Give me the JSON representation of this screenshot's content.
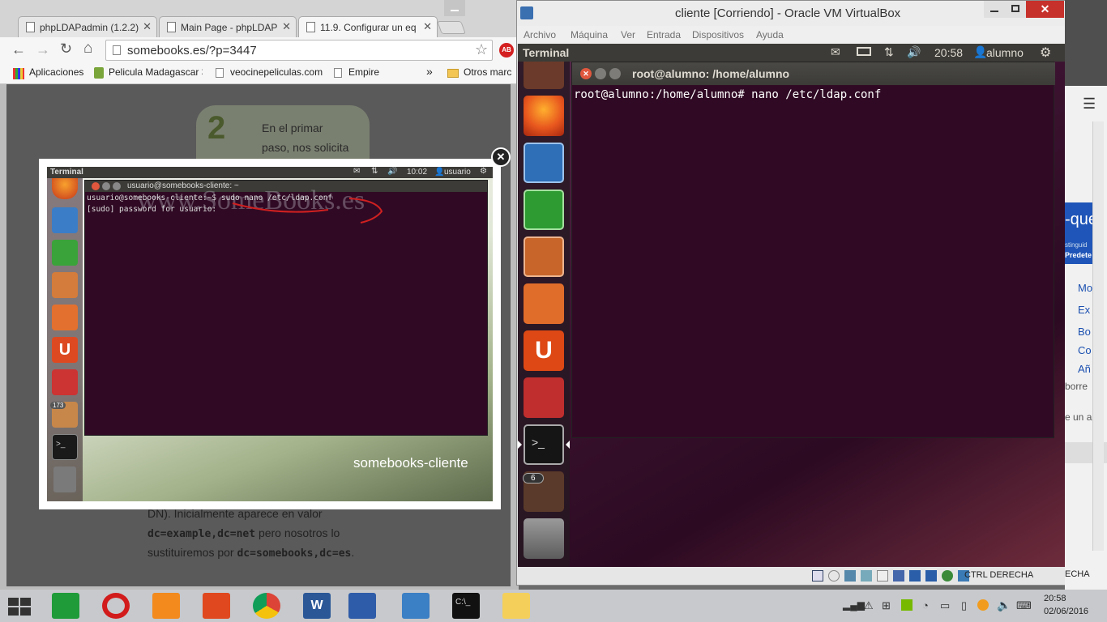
{
  "chrome": {
    "tabs": [
      {
        "label": "phpLDAPadmin (1.2.2)"
      },
      {
        "label": "Main Page - phpLDAP"
      },
      {
        "label": "11.9. Configurar un eq"
      }
    ],
    "url": "somebooks.es/?p=3447",
    "bookmarks": [
      {
        "label": "Aplicaciones"
      },
      {
        "label": "Pelicula Madagascar 3"
      },
      {
        "label": "veocinepeliculas.com"
      },
      {
        "label": "Empire"
      },
      {
        "label": "Otros marc"
      }
    ],
    "more": "»"
  },
  "article": {
    "step_number": "2",
    "step_text_1": "En el primar",
    "step_text_2": "paso, nos solicita",
    "body_1": "DN). Inicialmente aparece en valor",
    "code_1": "dc=example,dc=net",
    "body_2": " pero nosotros lo",
    "body_3": "sustituiremos por ",
    "code_2": "dc=somebooks,dc=es",
    "body_4": "."
  },
  "popup": {
    "close": "✕",
    "panel_title": "Terminal",
    "clock": "10:02",
    "user": "usuario",
    "window_title": "usuario@somebooks-cliente: ~",
    "line1": "usuario@somebooks-cliente:~$ sudo nano /etc/ldap.conf",
    "line2": "[sudo] password for usuario:",
    "watermark": "www.SomeBooks.es",
    "hostname": "somebooks-cliente",
    "badge": "173"
  },
  "vbox": {
    "title": "cliente [Corriendo] - Oracle VM VirtualBox",
    "menu": [
      "Archivo",
      "Máquina",
      "Ver",
      "Entrada",
      "Dispositivos",
      "Ayuda"
    ],
    "panel_title": "Terminal",
    "clock": "20:58",
    "user": "alumno",
    "term_title": "root@alumno: /home/alumno",
    "term_line": "root@alumno:/home/alumno# nano /etc/ldap.conf",
    "badge": "6",
    "host_key": "CTRL DERECHA"
  },
  "rstrip": {
    "heading": "-que",
    "sub1": "stinguid",
    "sub2": "Predete",
    "items": [
      "Mo",
      "Ex",
      "Bo",
      "Co",
      "Añ"
    ],
    "text1": "borre",
    "text2": "e un a",
    "status": "ECHA"
  },
  "taskbar": {
    "time": "20:58",
    "date": "02/06/2016"
  },
  "colors": {
    "ubuntu_term": "#300a24",
    "unity_panel": "#3c3b37",
    "taskbar": "#c7c9cc"
  }
}
